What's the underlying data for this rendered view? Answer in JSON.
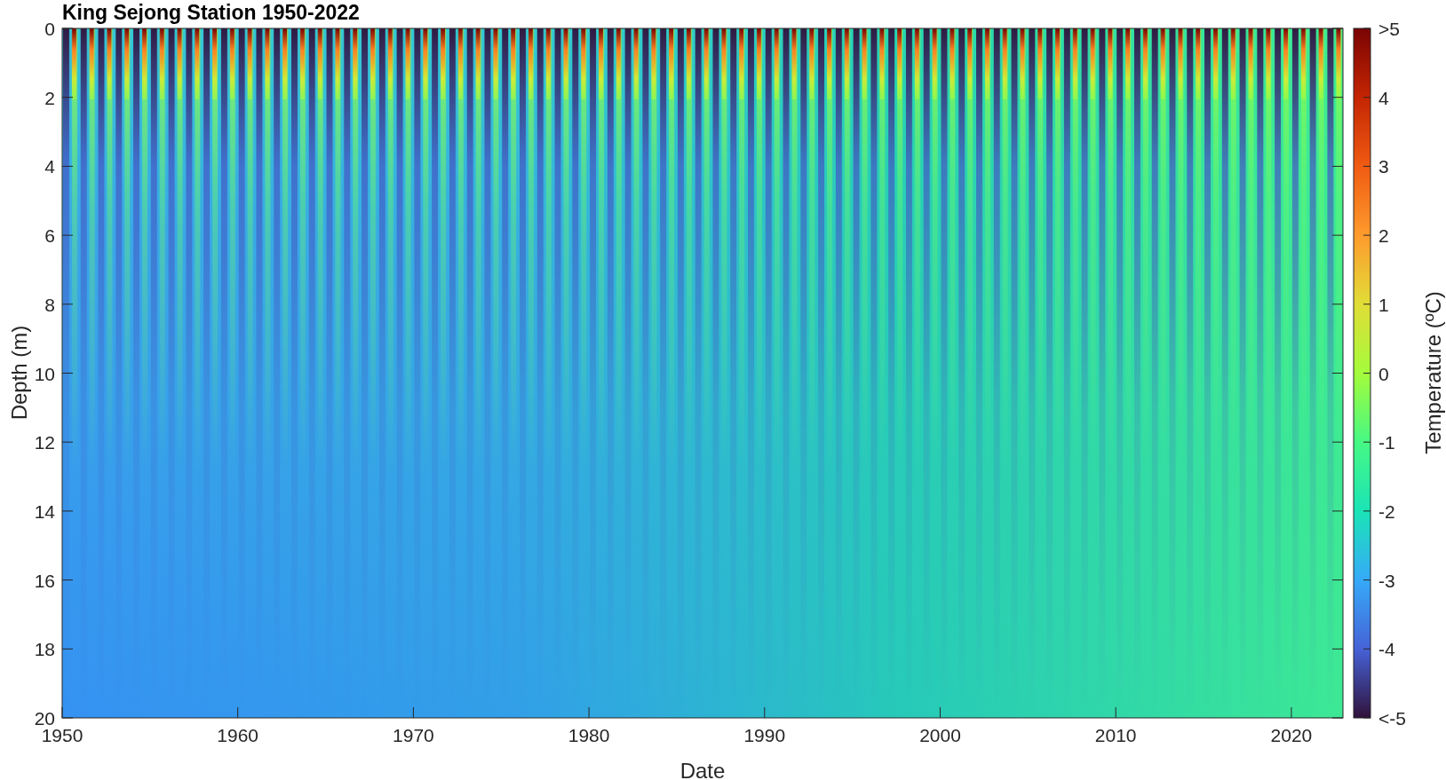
{
  "title": "King Sejong Station 1950-2022",
  "x_axis": {
    "label": "Date",
    "ticks": [
      "1950",
      "1960",
      "1970",
      "1980",
      "1990",
      "2000",
      "2010",
      "2020"
    ]
  },
  "y_axis": {
    "label": "Depth (m)",
    "ticks": [
      "0",
      "2",
      "4",
      "6",
      "8",
      "10",
      "12",
      "14",
      "16",
      "18",
      "20"
    ]
  },
  "colorbar": {
    "label": "Temperature (ºC)",
    "ticks": [
      ">5",
      "4",
      "3",
      "2",
      "1",
      "0",
      "-1",
      "-2",
      "-3",
      "-4",
      "<-5"
    ]
  }
}
